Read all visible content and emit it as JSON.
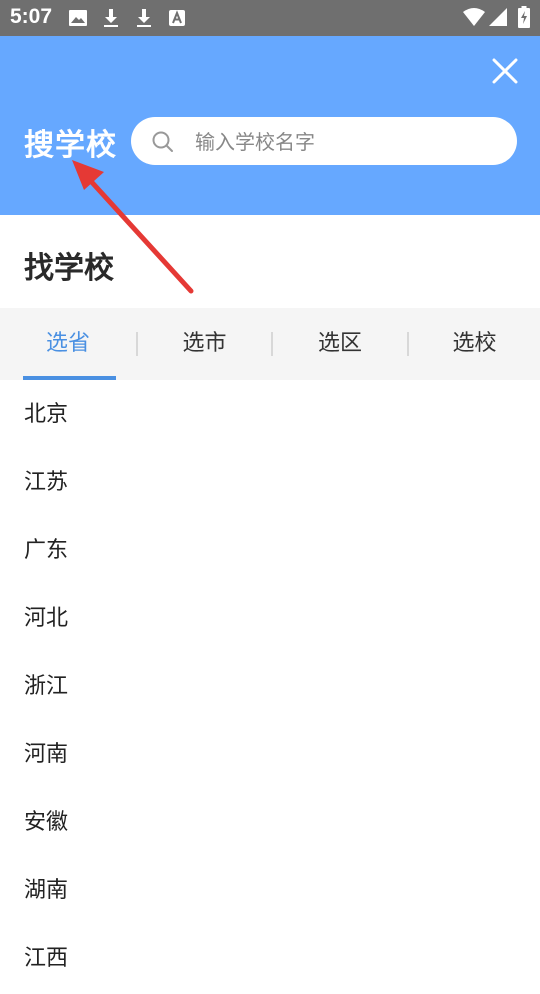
{
  "status_bar": {
    "time": "5:07",
    "left_icons": [
      "image-icon",
      "download-icon",
      "download-icon",
      "font-icon"
    ],
    "right_icons": [
      "wifi-icon",
      "signal-icon",
      "battery-icon"
    ]
  },
  "header": {
    "title": "搜学校",
    "search_placeholder": "输入学校名字",
    "background": "#66a8ff"
  },
  "section": {
    "title": "找学校"
  },
  "tabs": [
    {
      "label": "选省",
      "active": true
    },
    {
      "label": "选市",
      "active": false
    },
    {
      "label": "选区",
      "active": false
    },
    {
      "label": "选校",
      "active": false
    }
  ],
  "accent_color": "#4a90e2",
  "provinces": [
    "北京",
    "江苏",
    "广东",
    "河北",
    "浙江",
    "河南",
    "安徽",
    "湖南",
    "江西"
  ],
  "annotation": {
    "arrow_color": "#e53935"
  }
}
